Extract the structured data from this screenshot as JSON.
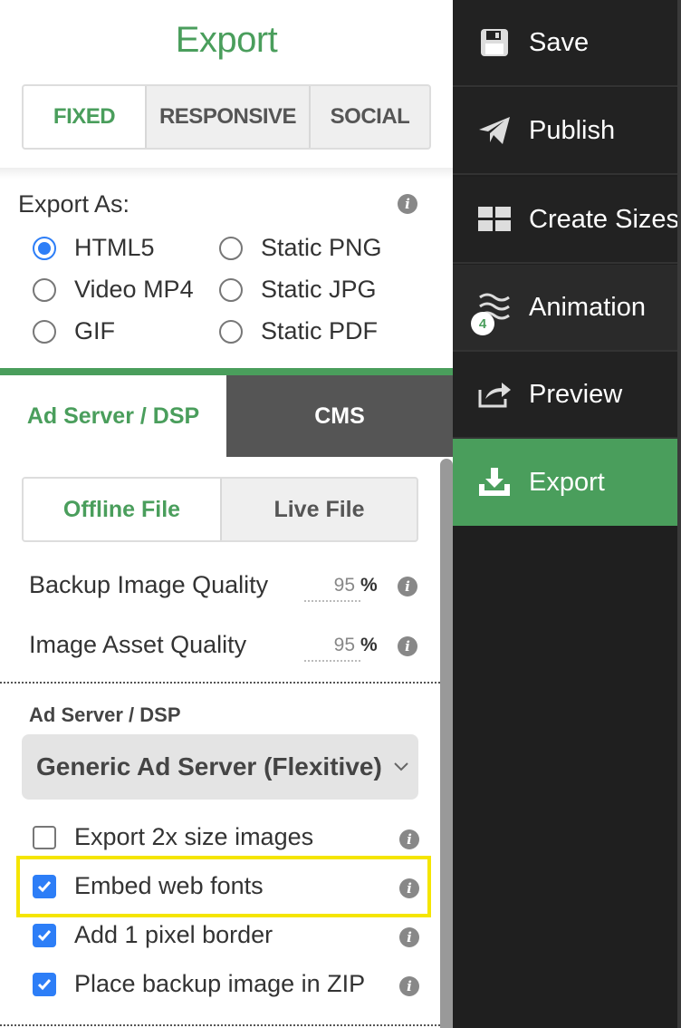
{
  "export_panel": {
    "title": "Export",
    "format_tabs": [
      {
        "label": "FIXED",
        "active": true
      },
      {
        "label": "RESPONSIVE",
        "active": false
      },
      {
        "label": "SOCIAL",
        "active": false
      }
    ],
    "export_as_label": "Export As:",
    "export_options": [
      {
        "label": "HTML5",
        "selected": true
      },
      {
        "label": "Static PNG",
        "selected": false
      },
      {
        "label": "Video MP4",
        "selected": false
      },
      {
        "label": "Static JPG",
        "selected": false
      },
      {
        "label": "GIF",
        "selected": false
      },
      {
        "label": "Static PDF",
        "selected": false
      }
    ],
    "target_tabs": [
      {
        "label": "Ad Server / DSP",
        "active": true
      },
      {
        "label": "CMS",
        "active": false
      }
    ],
    "file_tabs": [
      {
        "label": "Offline File",
        "active": true
      },
      {
        "label": "Live File",
        "active": false
      }
    ],
    "quality": [
      {
        "label": "Backup Image Quality",
        "value": "95",
        "unit": "%"
      },
      {
        "label": "Image Asset Quality",
        "value": "95",
        "unit": "%"
      }
    ],
    "ad_server_label": "Ad Server / DSP",
    "ad_server_selected": "Generic Ad Server (Flexitive)",
    "checkboxes": [
      {
        "label": "Export 2x size images",
        "checked": false
      },
      {
        "label": "Embed web fonts",
        "checked": true
      },
      {
        "label": "Add 1 pixel border",
        "checked": true
      },
      {
        "label": "Place backup image in ZIP",
        "checked": true
      }
    ],
    "info_glyph": "i"
  },
  "sidebar": {
    "items": [
      {
        "label": "Save",
        "icon": "floppy-disk-icon"
      },
      {
        "label": "Publish",
        "icon": "paper-plane-icon"
      },
      {
        "label": "Create Sizes",
        "icon": "grid-icon"
      },
      {
        "label": "Animation",
        "icon": "waves-icon",
        "badge": "4"
      },
      {
        "label": "Preview",
        "icon": "share-icon"
      },
      {
        "label": "Export",
        "icon": "download-tray-icon",
        "active": true
      }
    ]
  },
  "colors": {
    "accent_green": "#4a9e5c",
    "sidebar_bg": "#222222",
    "selected_blue": "#2d7ef7",
    "highlight_yellow": "#f5e500"
  }
}
